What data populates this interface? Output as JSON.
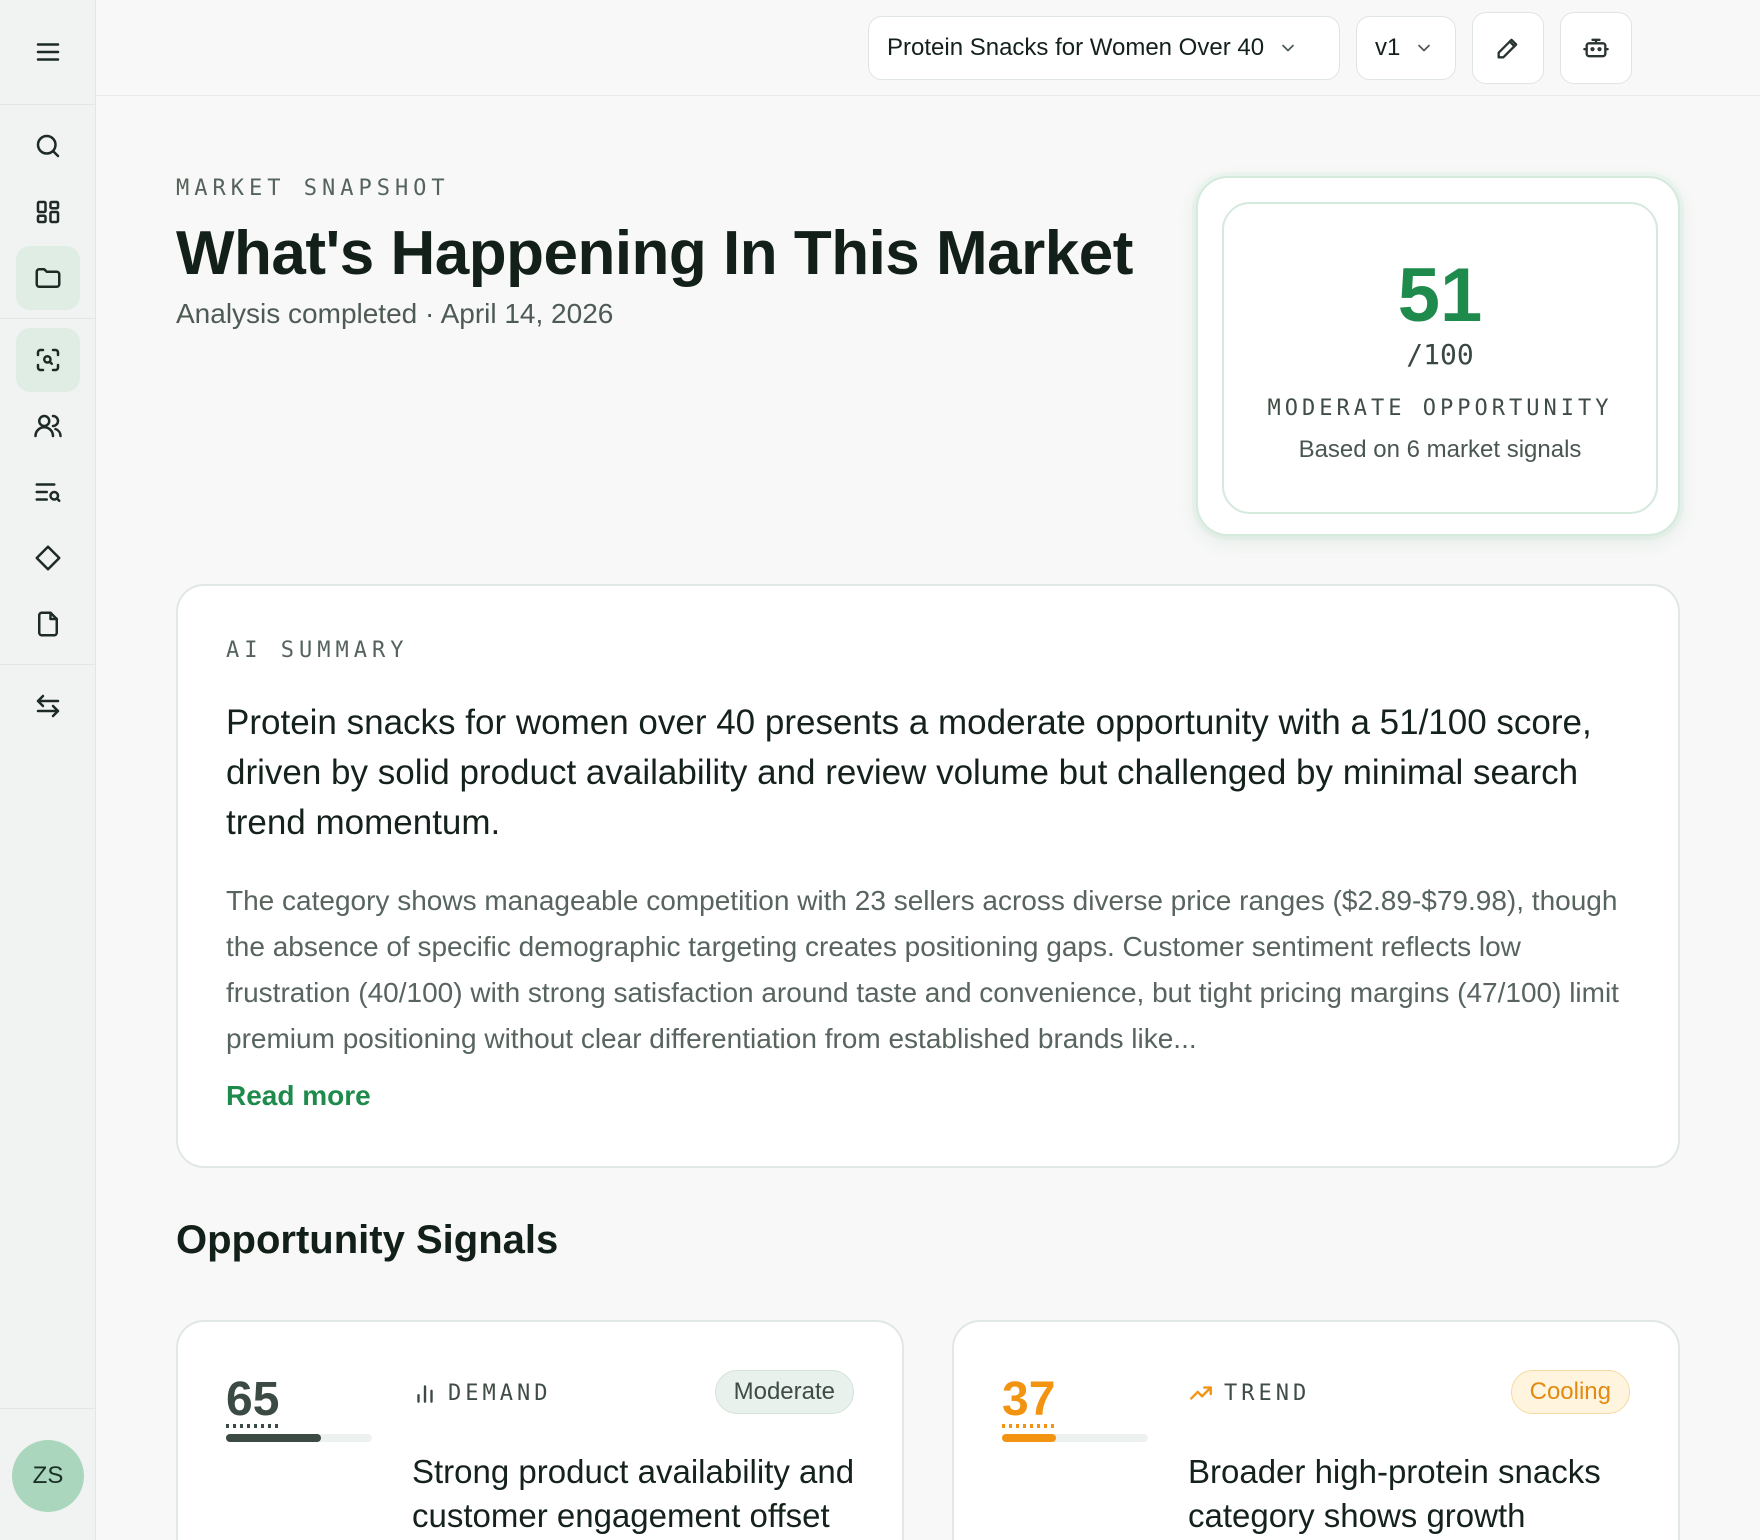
{
  "topbar": {
    "project_select": "Protein Snacks for Women Over 40",
    "version_select": "v1"
  },
  "header": {
    "eyebrow": "MARKET SNAPSHOT",
    "title": "What's Happening In This Market",
    "subtitle": "Analysis completed · April 14, 2026"
  },
  "score": {
    "value": "51",
    "denominator": "/100",
    "label": "MODERATE OPPORTUNITY",
    "basis": "Based on 6 market signals"
  },
  "summary": {
    "eyebrow": "AI SUMMARY",
    "headline": "Protein snacks for women over 40 presents a moderate opportunity with a 51/100 score, driven by solid product availability and review volume but challenged by minimal search trend momentum.",
    "body": "The category shows manageable competition with 23 sellers across diverse price ranges ($2.89-$79.98), though the absence of specific demographic targeting creates positioning gaps. Customer sentiment reflects low frustration (40/100) with strong satisfaction around taste and convenience, but tight pricing margins (47/100) limit premium positioning without clear differentiation from established brands like...",
    "read_more": "Read more"
  },
  "signals": {
    "title": "Opportunity Signals",
    "cards": [
      {
        "score": "65",
        "progress": 0.65,
        "label": "DEMAND",
        "icon": "bar-chart-icon",
        "badge": "Moderate",
        "headline": "Strong product availability and customer engagement offset minimal search",
        "color": "#3c4a44",
        "badge_bg": "#e8f1ec",
        "badge_fg": "#3e4c45",
        "badge_border": "#d5e2da"
      },
      {
        "score": "37",
        "progress": 0.37,
        "label": "TREND",
        "icon": "trending-up-icon",
        "badge": "Cooling",
        "headline": "Broader high-protein snacks category shows growth momentum, but women",
        "color": "#f29412",
        "badge_bg": "#fff4de",
        "badge_fg": "#e38a10",
        "badge_border": "#f6d9a3"
      }
    ]
  },
  "user": {
    "initials": "ZS"
  }
}
